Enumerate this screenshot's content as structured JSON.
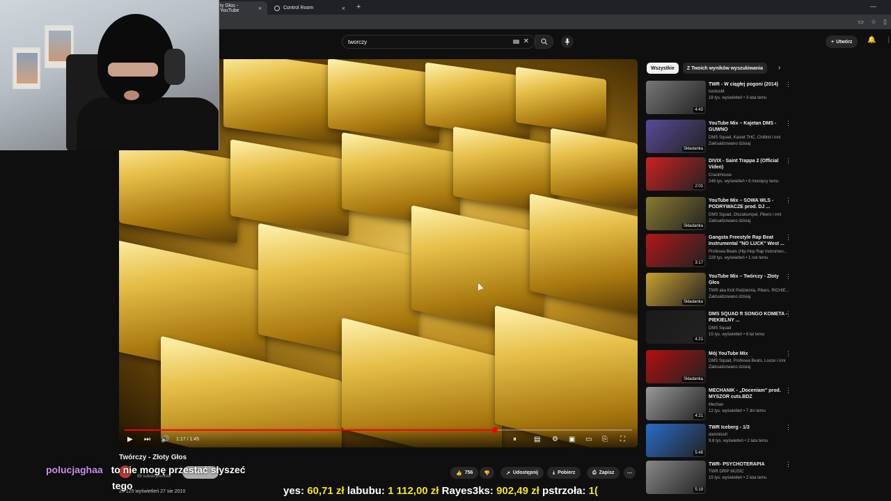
{
  "browser": {
    "tabs": [
      {
        "label": "ty Głos - YouTube",
        "active": true
      },
      {
        "label": "Control Room",
        "active": false
      }
    ],
    "new_tab": "+",
    "close": "×"
  },
  "youtube": {
    "search_value": "tworczy",
    "create_label": "Utwórz",
    "chips": [
      "Wszystkie",
      "Z Twoich wyników wyszukiwania"
    ]
  },
  "video": {
    "time": "1:17 / 1:45",
    "progress": 0.73,
    "title": "Twórczy - Złoty Głos",
    "subscribers": "99 subskrybentów",
    "likes": "756",
    "share": "Udostępnij",
    "download": "Pobierz",
    "save": "Zapisz",
    "views_date": "25 125 wyświetleń  27 sie 2010"
  },
  "chat": {
    "user": "polucjaghaa",
    "line1": "to nie mogę przestać słyszeć",
    "line2": "tego"
  },
  "ticker": {
    "text_prefix": "yes: ",
    "items": [
      {
        "name": "",
        "amount": "60,71 zł"
      },
      {
        "name": "labubu: ",
        "amount": "1 112,00 zł"
      },
      {
        "name": "Rayes3ks: ",
        "amount": "902,49 zł"
      },
      {
        "name": "pstrzoła: ",
        "amount": "1("
      }
    ]
  },
  "recommendations": [
    {
      "title": "TWR - W ciągłej pogoni (2014)",
      "meta1": "tonitosM",
      "meta2": "18 tys. wyświetleń • 3 lata temu",
      "duration": "4:43",
      "thumb_color": "#777"
    },
    {
      "title": "YouTube Mix – Kajetan DMS - GUWNO",
      "meta1": "DMS Squad, Kastet THC, Chillinit i inni",
      "meta2": "Zaktualizowano dzisiaj",
      "duration": "Składanka",
      "thumb_color": "#5a4a9a"
    },
    {
      "title": "DIVIX - Saint Trappa 2 (Official Video)",
      "meta1": "CrackHouse",
      "meta2": "248 tys. wyświetleń • 8 miesięcy temu",
      "duration": "2:01",
      "thumb_color": "#c22"
    },
    {
      "title": "YouTube Mix – SOWA WLS - PODRYWACZE prod. DJ ...",
      "meta1": "DMS Squad, Olszakumpel, Pikers i inni",
      "meta2": "Zaktualizowano dzisiaj",
      "duration": "Składanka",
      "thumb_color": "#8a7a30"
    },
    {
      "title": "Gangsta Freestyle Rap Beat Instrumental \"NO LUCK\" West ...",
      "meta1": "Profesea Beats (Hip-Hop Rap Instrumen...",
      "meta2": "229 tys. wyświetleń • 1 rok temu",
      "duration": "3:17",
      "thumb_color": "#b01818"
    },
    {
      "title": "YouTube Mix – Twórczy - Złoty Głos",
      "meta1": "TWR aka Król Podziemia, Pikers, RICHIE...",
      "meta2": "Zaktualizowano dzisiaj",
      "duration": "Składanka",
      "thumb_color": "#c9a030"
    },
    {
      "title": "DMS SQUAD ft SONGO KOMETA - PIEKIELNY ...",
      "meta1": "DMS Squad",
      "meta2": "15 tys. wyświetleń • 8 lat temu",
      "duration": "4:21",
      "thumb_color": "#1a1a1a"
    },
    {
      "title": "Mój YouTube Mix",
      "meta1": "DMS Squad, Profesea Beats, Looze i inni",
      "meta2": "Zaktualizowano dzisiaj",
      "duration": "Składanka",
      "thumb_color": "#b01010"
    },
    {
      "title": "MECHANIK - „Doceniam\" prod. MYSZOR cuts.BDZ",
      "meta1": "Mechan",
      "meta2": "12 tys. wyświetleń • 7 dni temu",
      "duration": "4:21",
      "thumb_color": "#999"
    },
    {
      "title": "TWR Iceberg - 1/3",
      "meta1": "damniluvit",
      "meta2": "9,8 tys. wyświetleń • 2 lata temu",
      "duration": "5:48",
      "thumb_color": "#2a6cc9"
    },
    {
      "title": "TWR- PSYCHOTERAPIA",
      "meta1": "TWR DRIP MUSIC",
      "meta2": "15 tys. wyświetleń • 2 lata temu",
      "duration": "5:19",
      "thumb_color": "#888"
    }
  ]
}
